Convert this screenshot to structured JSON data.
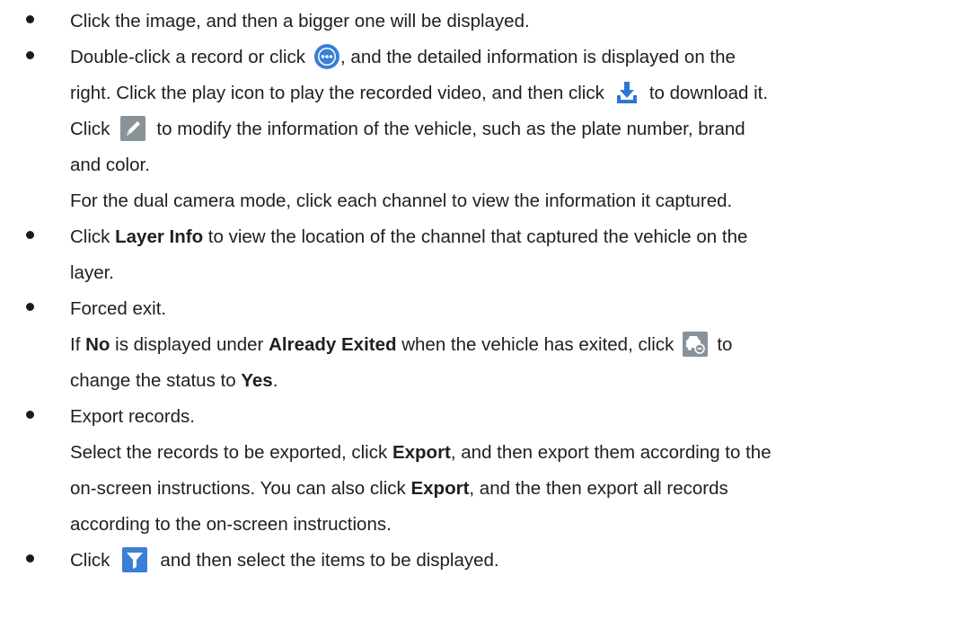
{
  "items": [
    {
      "line1": "Click the image, and then a bigger one will be displayed."
    },
    {
      "line1_a": "Double-click a record or click",
      "line1_b": ", and the detailed information is displayed on the",
      "line2_a": "right. Click the play icon to play the recorded video, and then click",
      "line2_b": "to download it.",
      "line3_a": "Click",
      "line3_b": "to modify the information of the vehicle, such as the plate number, brand",
      "line4": "and color.",
      "line5": "For the dual camera mode, click each channel to view the information it captured."
    },
    {
      "line1_a": "Click",
      "line1_bold": "Layer Info",
      "line1_b": "to view the location of the channel that captured the vehicle on the",
      "line2": "layer."
    },
    {
      "line1": "Forced exit.",
      "line2_a": "If",
      "line2_bold1": "No",
      "line2_b": "is displayed under",
      "line2_bold2": "Already Exited",
      "line2_c": "when the vehicle has exited, click",
      "line2_d": "to",
      "line3_a": "change the status to",
      "line3_bold": "Yes",
      "line3_b": "."
    },
    {
      "line1": "Export records.",
      "line2_a": "Select the records to be exported, click",
      "line2_bold": "Export",
      "line2_b": ", and then export them according to the",
      "line3_a": "on-screen instructions. You can also click",
      "line3_bold": "Export",
      "line3_b": ", and the then export all records",
      "line4": "according to the on-screen instructions."
    },
    {
      "line1_a": "Click",
      "line1_b": "and then select the items to be displayed."
    }
  ],
  "icons": {
    "more": "more-circle-icon",
    "download": "download-icon",
    "edit": "edit-pencil-icon",
    "force_exit": "vehicle-exit-icon",
    "filter": "filter-funnel-icon"
  },
  "colors": {
    "icon_blue": "#3b7fd6",
    "icon_grey_bg": "#8a9299",
    "text": "#1f1f1f"
  }
}
